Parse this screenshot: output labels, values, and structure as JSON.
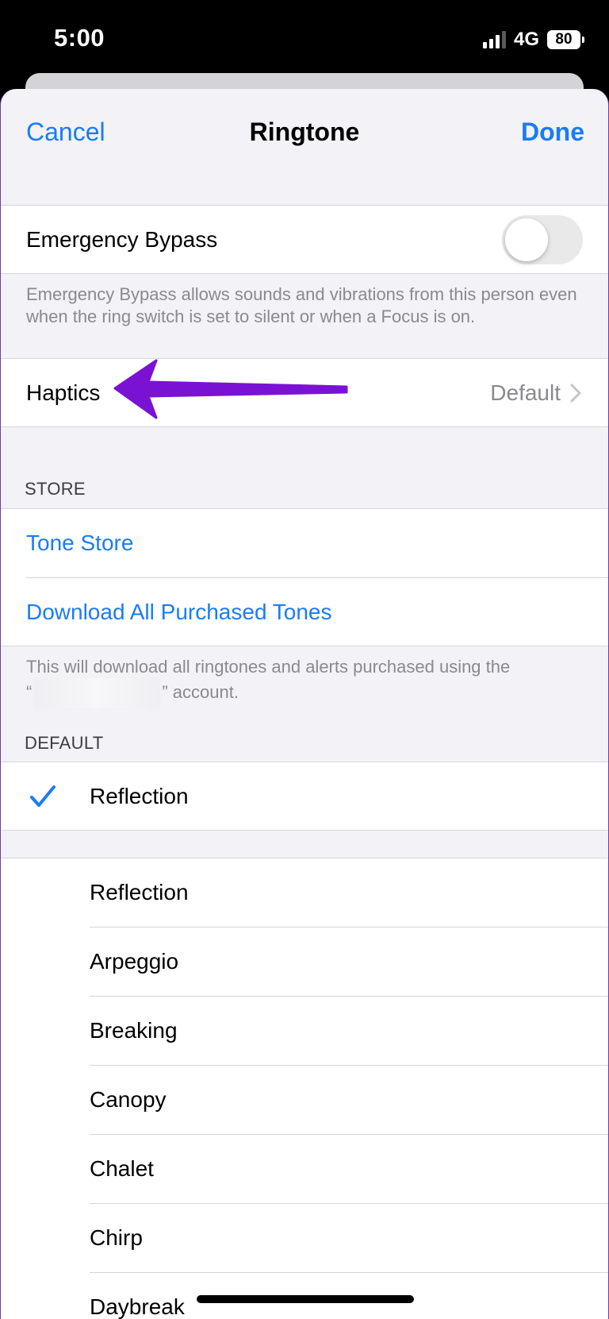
{
  "status_bar": {
    "time": "5:00",
    "network": "4G",
    "battery": "80",
    "signal_icon": "signal-bars-icon"
  },
  "nav": {
    "cancel_label": "Cancel",
    "title": "Ringtone",
    "done_label": "Done"
  },
  "emergency_bypass": {
    "label": "Emergency Bypass",
    "enabled": false,
    "footer": "Emergency Bypass allows sounds and vibrations from this person even when the ring switch is set to silent or when a Focus is on."
  },
  "haptics": {
    "label": "Haptics",
    "value": "Default"
  },
  "store": {
    "header": "STORE",
    "tone_store_label": "Tone Store",
    "download_label": "Download All Purchased Tones",
    "footer_line1": "This will download all ringtones and alerts purchased using the",
    "footer_line2_prefix": "“",
    "footer_line2_suffix": "” account."
  },
  "default_section": {
    "header": "DEFAULT",
    "selected": "Reflection"
  },
  "ringtones": [
    "Reflection",
    "Arpeggio",
    "Breaking",
    "Canopy",
    "Chalet",
    "Chirp",
    "Daybreak"
  ],
  "colors": {
    "accent": "#1a7cf5",
    "annotation_arrow": "#7a12d4"
  }
}
